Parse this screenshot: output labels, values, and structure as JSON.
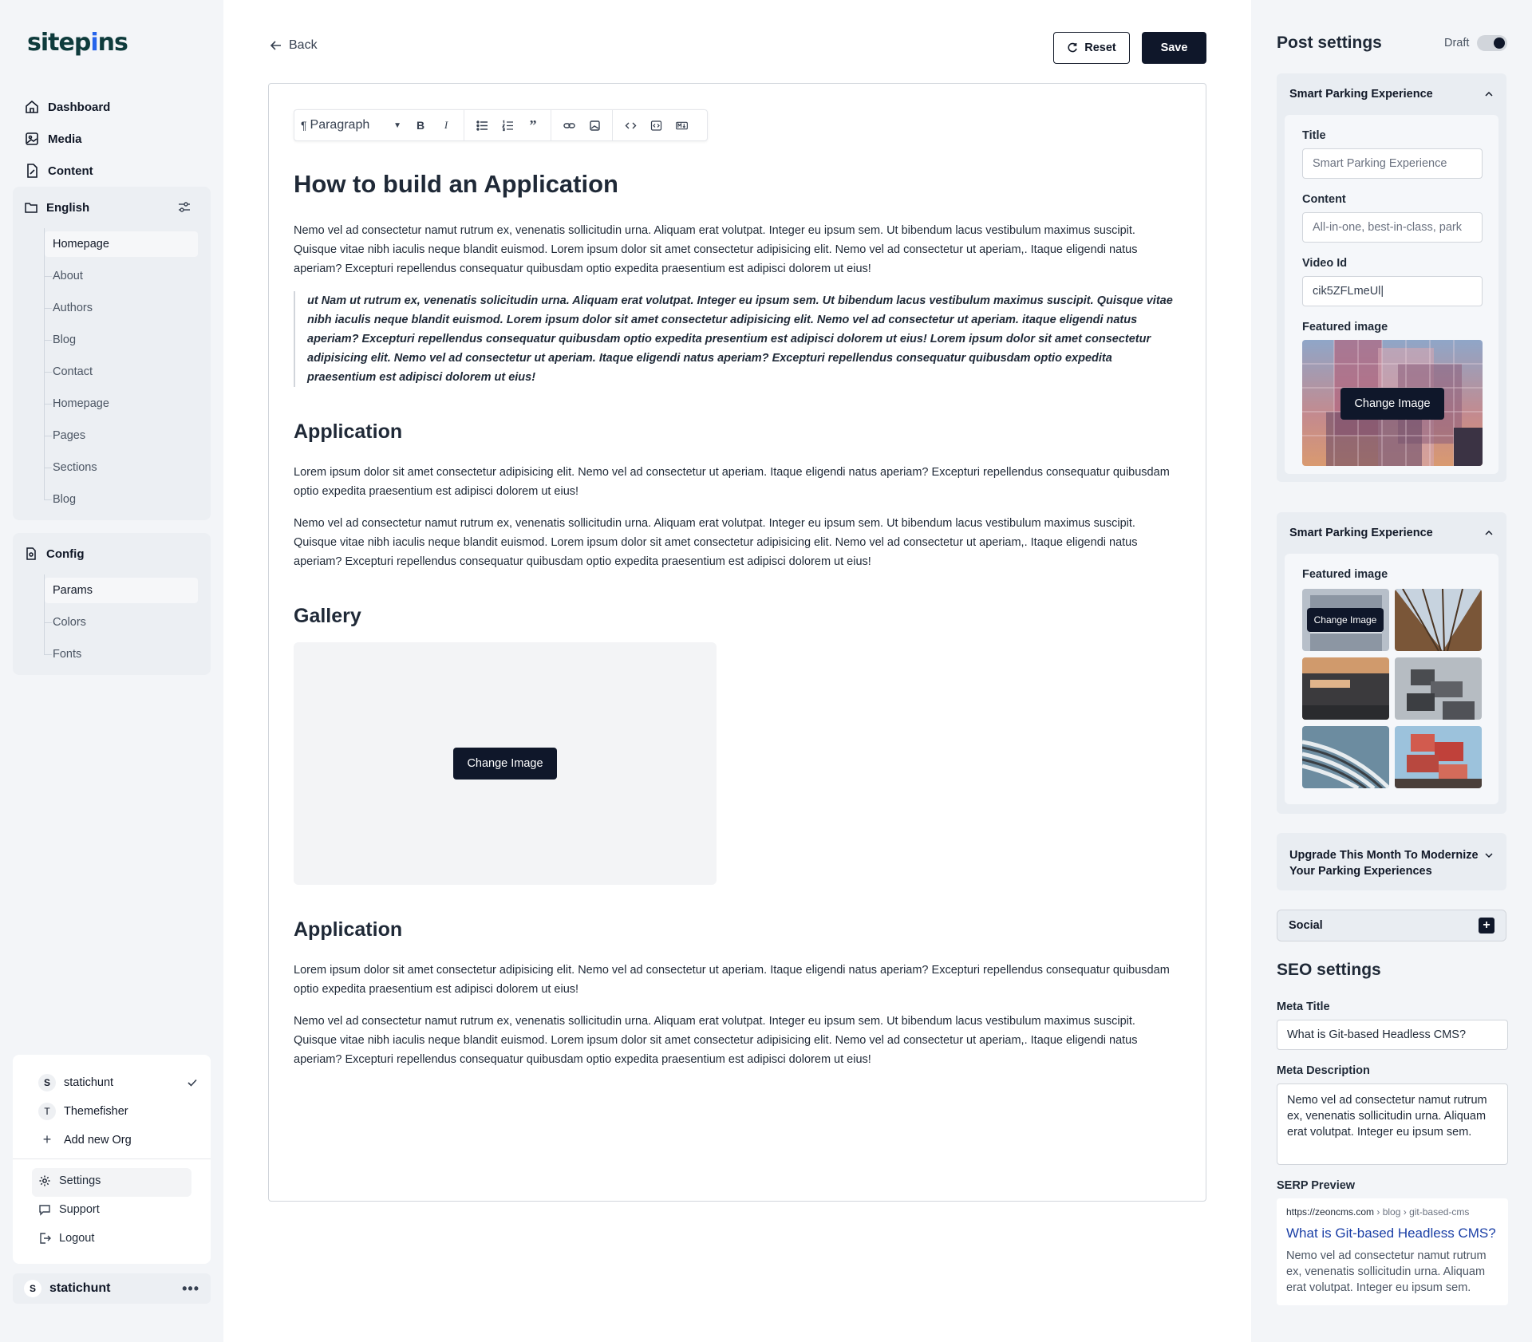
{
  "sidebar": {
    "logo": "sitepins",
    "nav": [
      {
        "label": "Dashboard",
        "icon": "home-icon"
      },
      {
        "label": "Media",
        "icon": "image-icon"
      },
      {
        "label": "Content",
        "icon": "file-edit-icon"
      }
    ],
    "content_group": {
      "title": "English",
      "items": [
        "Homepage",
        "About",
        "Authors",
        "Blog",
        "Contact",
        "Homepage",
        "Pages",
        "Sections",
        "Blog"
      ],
      "active_index": 0
    },
    "config_group": {
      "title": "Config",
      "items": [
        "Params",
        "Colors",
        "Fonts"
      ],
      "active_index": 0
    },
    "orgs": [
      {
        "badge": "S",
        "name": "statichunt",
        "selected": true
      },
      {
        "badge": "T",
        "name": "Themefisher",
        "selected": false
      }
    ],
    "add_org_label": "Add new Org",
    "utility": [
      {
        "label": "Settings",
        "icon": "gear-icon"
      },
      {
        "label": "Support",
        "icon": "chat-icon"
      },
      {
        "label": "Logout",
        "icon": "logout-icon"
      }
    ],
    "current_user": {
      "badge": "S",
      "name": "statichunt"
    }
  },
  "header": {
    "back_label": "Back",
    "reset_label": "Reset",
    "save_label": "Save"
  },
  "toolbar": {
    "block_type": "Paragraph",
    "buttons": [
      "bold",
      "italic",
      "bullet-list",
      "ordered-list",
      "quote",
      "link",
      "image",
      "code",
      "embed",
      "markdown"
    ]
  },
  "document": {
    "title": "How to build an Application",
    "p1": "Nemo vel ad consectetur namut rutrum ex, venenatis sollicitudin urna. Aliquam erat volutpat. Integer eu ipsum sem. Ut bibendum lacus vestibulum maximus suscipit. Quisque vitae nibh iaculis neque blandit euismod. Lorem ipsum dolor sit amet consectetur adipisicing elit. Nemo vel ad consectetur ut aperiam,. Itaque eligendi natus aperiam? Excepturi repellendus consequatur quibusdam optio expedita praesentium est adipisci dolorem ut eius!",
    "quote": "ut Nam ut rutrum ex, venenatis solicitudin urna. Aliquam erat volutpat. Integer eu ipsum sem. Ut bibendum lacus vestibulum maximus suscipit. Quisque vitae nibh iaculis neque blandit euismod. Lorem ipsum dolor sit amet consectetur adipisicing elit. Nemo vel ad consectetur ut aperiam. itaque eligendi natus aperiam? Excepturi repellendus consequatur quibusdam optio expedita presentium est adipisci dolorem ut eius! Lorem ipsum dolor sit amet consectetur adipisicing elit. Nemo vel ad consectetur ut aperiam. Itaque eligendi natus aperiam? Excepturi repellendus consequatur quibusdam optio expedita praesentium est adipisci dolorem ut eius!",
    "h2_application": "Application",
    "p2": "Lorem ipsum dolor sit amet consectetur adipisicing elit. Nemo vel ad consectetur ut aperiam. Itaque eligendi natus aperiam? Excepturi repellendus consequatur quibusdam optio expedita praesentium est adipisci dolorem ut eius!",
    "p3": "Nemo vel ad consectetur namut rutrum ex, venenatis sollicitudin urna. Aliquam erat volutpat. Integer eu ipsum sem. Ut bibendum lacus vestibulum maximus suscipit. Quisque vitae nibh iaculis neque blandit euismod. Lorem ipsum dolor sit amet consectetur adipisicing elit. Nemo vel ad consectetur ut aperiam,. Itaque eligendi natus aperiam? Excepturi repellendus consequatur quibusdam optio expedita praesentium est adipisci dolorem ut eius!",
    "h2_gallery": "Gallery",
    "gallery_change_label": "Change Image",
    "h2_application_2": "Application",
    "p4": "Lorem ipsum dolor sit amet consectetur adipisicing elit. Nemo vel ad consectetur ut aperiam. Itaque eligendi natus aperiam? Excepturi repellendus consequatur quibusdam optio expedita praesentium est adipisci dolorem ut eius!",
    "p5": "Nemo vel ad consectetur namut rutrum ex, venenatis sollicitudin urna. Aliquam erat volutpat. Integer eu ipsum sem. Ut bibendum lacus vestibulum maximus suscipit. Quisque vitae nibh iaculis neque blandit euismod. Lorem ipsum dolor sit amet consectetur adipisicing elit. Nemo vel ad consectetur ut aperiam,. Itaque eligendi natus aperiam? Excepturi repellendus consequatur quibusdam optio expedita praesentium est adipisci dolorem ut eius!"
  },
  "post_settings": {
    "title": "Post settings",
    "draft_label": "Draft",
    "draft_on": true,
    "card1": {
      "heading": "Smart Parking Experience",
      "title_label": "Title",
      "title_value": "Smart Parking Experience",
      "content_label": "Content",
      "content_value": "All-in-one, best-in-class, park",
      "video_label": "Video Id",
      "video_value": "cik5ZFLmeUl|",
      "featured_label": "Featured image",
      "change_label": "Change Image"
    },
    "card2": {
      "heading": "Smart Parking Experience",
      "featured_label": "Featured image",
      "change_label": "Change Image"
    },
    "card3": {
      "heading_line1": "Upgrade This Month To Modernize",
      "heading_line2": "Your Parking Experiences"
    },
    "social_label": "Social"
  },
  "seo": {
    "title": "SEO settings",
    "meta_title_label": "Meta Title",
    "meta_title_value": "What is Git-based Headless CMS?",
    "meta_desc_label": "Meta Description",
    "meta_desc_value": "Nemo vel ad consectetur namut rutrum ex, venenatis sollicitudin urna. Aliquam erat volutpat. Integer eu ipsum sem.",
    "serp_label": "SERP Preview",
    "serp_url": "https://zeoncms.com",
    "serp_crumb": "› blog › git-based-cms",
    "serp_title": "What is Git-based Headless CMS?",
    "serp_desc": "Nemo vel ad consectetur namut rutrum ex, venenatis sollicitudin urna. Aliquam erat volutpat. Integer eu ipsum sem."
  },
  "colors": {
    "primary_dark": "#0f172a",
    "sidebar_bg": "#f3f5f8",
    "link_blue": "#1a3fa6",
    "logo_teal": "#0e3b3c"
  }
}
